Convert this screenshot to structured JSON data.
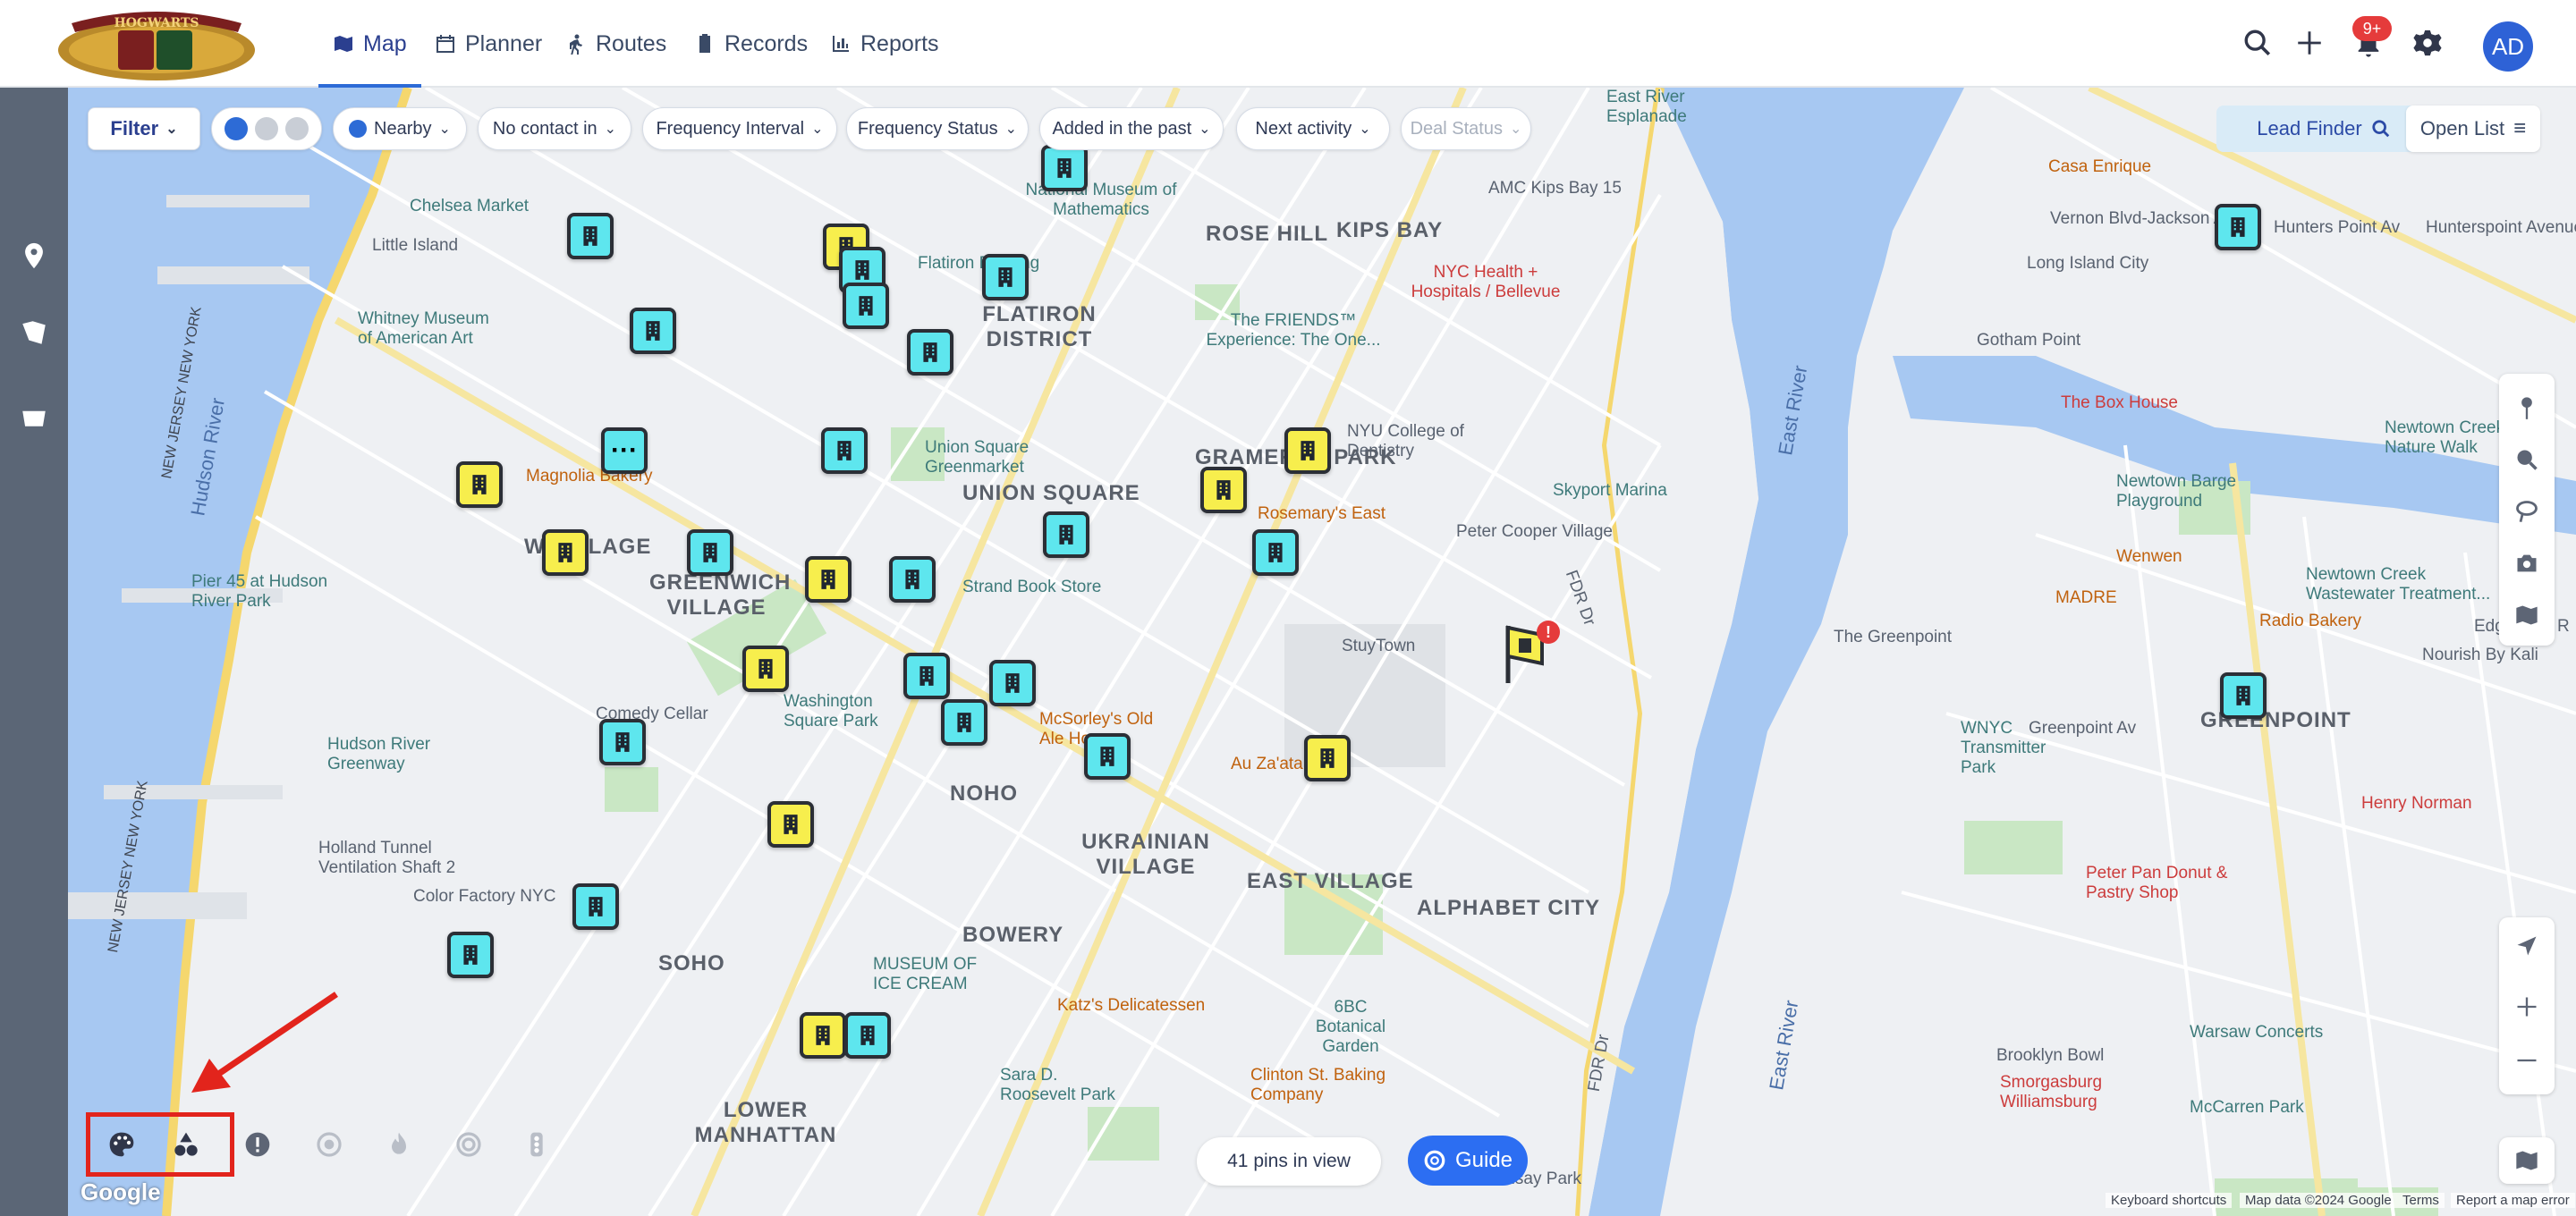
{
  "nav": {
    "logo_alt": "HOGWARTS",
    "items": [
      {
        "label": "Map",
        "icon": "map-icon",
        "active": true
      },
      {
        "label": "Planner",
        "icon": "calendar-icon"
      },
      {
        "label": "Routes",
        "icon": "hiker-icon"
      },
      {
        "label": "Records",
        "icon": "clipboard-icon"
      },
      {
        "label": "Reports",
        "icon": "chart-icon"
      }
    ],
    "notification_badge": "9+",
    "avatar_initials": "AD"
  },
  "filters": {
    "filter_label": "Filter",
    "chips": [
      "Nearby",
      "No contact in",
      "Frequency Interval",
      "Frequency Status",
      "Added in the past",
      "Next activity",
      "Deal Status"
    ],
    "lead_finder": "Lead Finder",
    "open_list": "Open List"
  },
  "map": {
    "pins_in_view": "41 pins in view",
    "guide_label": "Guide",
    "google": "Google",
    "attribution": {
      "shortcuts": "Keyboard shortcuts",
      "data": "Map data ©2024 Google",
      "terms": "Terms",
      "report": "Report a map error"
    },
    "labels": {
      "chelsea_market": "Chelsea Market",
      "little_island": "Little Island",
      "whitney": "Whitney Museum of American Art",
      "new_jersey_ny_1": "NEW JERSEY NEW YORK",
      "new_jersey_ny_2": "NEW JERSEY NEW YORK",
      "hudson_river": "Hudson River",
      "pier45": "Pier 45 at Hudson River Park",
      "flatiron": "FLATIRON DISTRICT",
      "flatiron_building": "Flatiron Building",
      "rose_hill": "ROSE HILL",
      "kips_bay": "KIPS BAY",
      "gramercy": "GRAMERCY PARK",
      "union_square": "UNION SQUARE",
      "union_greenmarket": "Union Square Greenmarket",
      "greenwich_village": "GREENWICH VILLAGE",
      "w_village": "W VILLAGE",
      "washington_sq": "Washington Square Park",
      "noho": "NOHO",
      "ukrainian_village": "UKRAINIAN VILLAGE",
      "east_village": "EAST VILLAGE",
      "alphabet_city": "ALPHABET CITY",
      "bowery": "BOWERY",
      "soho": "SOHO",
      "lower_manhattan": "LOWER MANHATTAN",
      "museum_ice_cream": "MUSEUM OF ICE CREAM",
      "katz": "Katz's Delicatessen",
      "mcsorleys": "McSorley's Old Ale House",
      "au_zaatar": "Au Za'atar",
      "stuytown": "StuyTown",
      "peter_cooper": "Peter Cooper Village",
      "nyc_health": "NYC Health + Hospitals / Bellevue",
      "friends": "The FRIENDS™ Experience: The One...",
      "nyu_dentistry": "NYU College of Dentistry",
      "rosemarys": "Rosemary's East",
      "skyport": "Skyport Marina",
      "amc_kips": "AMC Kips Bay 15",
      "east_river_esplanade": "East River Esplanade",
      "math_museum": "National Museum of Mathematics",
      "comedy_cellar": "Comedy Cellar",
      "hudson_greenway": "Hudson River Greenway",
      "holland_tunnel": "Holland Tunnel Ventilation Shaft 2",
      "color_factory": "Color Factory NYC",
      "strand": "Strand Book Store",
      "magnolia": "Magnolia Bakery",
      "sixbc": "6BC Botanical Garden",
      "clinton_st": "Clinton St. Baking Company",
      "sara_roosevelt": "Sara D. Roosevelt Park",
      "east_river_1": "East River",
      "east_river_2": "East River",
      "casa_enrique": "Casa Enrique",
      "vernon": "Vernon Blvd-Jackson Av",
      "hunters_point": "Hunters Point Av",
      "hunterspoint_ave": "Hunterspoint Avenue",
      "lic": "Long Island City",
      "gotham_point": "Gotham Point",
      "box_house": "The Box House",
      "newtown_creek_nature": "Newtown Creek Nature Walk",
      "newtown_barge": "Newtown Barge Playground",
      "wenwen": "Wenwen",
      "madre": "MADRE",
      "radio_bakery": "Radio Bakery",
      "greenpoint_hood": "GREENPOINT",
      "the_greenpoint": "The Greenpoint",
      "greenpoint_av": "Greenpoint Av",
      "wnyc": "WNYC Transmitter Park",
      "henry_norman": "Henry Norman",
      "peter_pan": "Peter Pan Donut & Pastry Shop",
      "warsaw": "Warsaw Concerts",
      "brooklyn_bowl": "Brooklyn Bowl",
      "smorgasburg": "Smorgasburg Williamsburg",
      "mccarren": "McCarren Park",
      "lindsay": "Lindsay Park",
      "edge_auto": "Edge Auto R",
      "nourish": "Nourish By Kali",
      "newtown_wastewater": "Newtown Creek Wastewater Treatment...",
      "fdr_1": "FDR Dr",
      "fdr_2": "FDR Dr"
    }
  },
  "colors": {
    "water": "#a7c8f2",
    "land": "#eef0f3",
    "pin_cyan": "#5ee6ee",
    "pin_yellow": "#f7ee4d",
    "accent": "#2c6ef2",
    "highlight": "#e2241c"
  }
}
